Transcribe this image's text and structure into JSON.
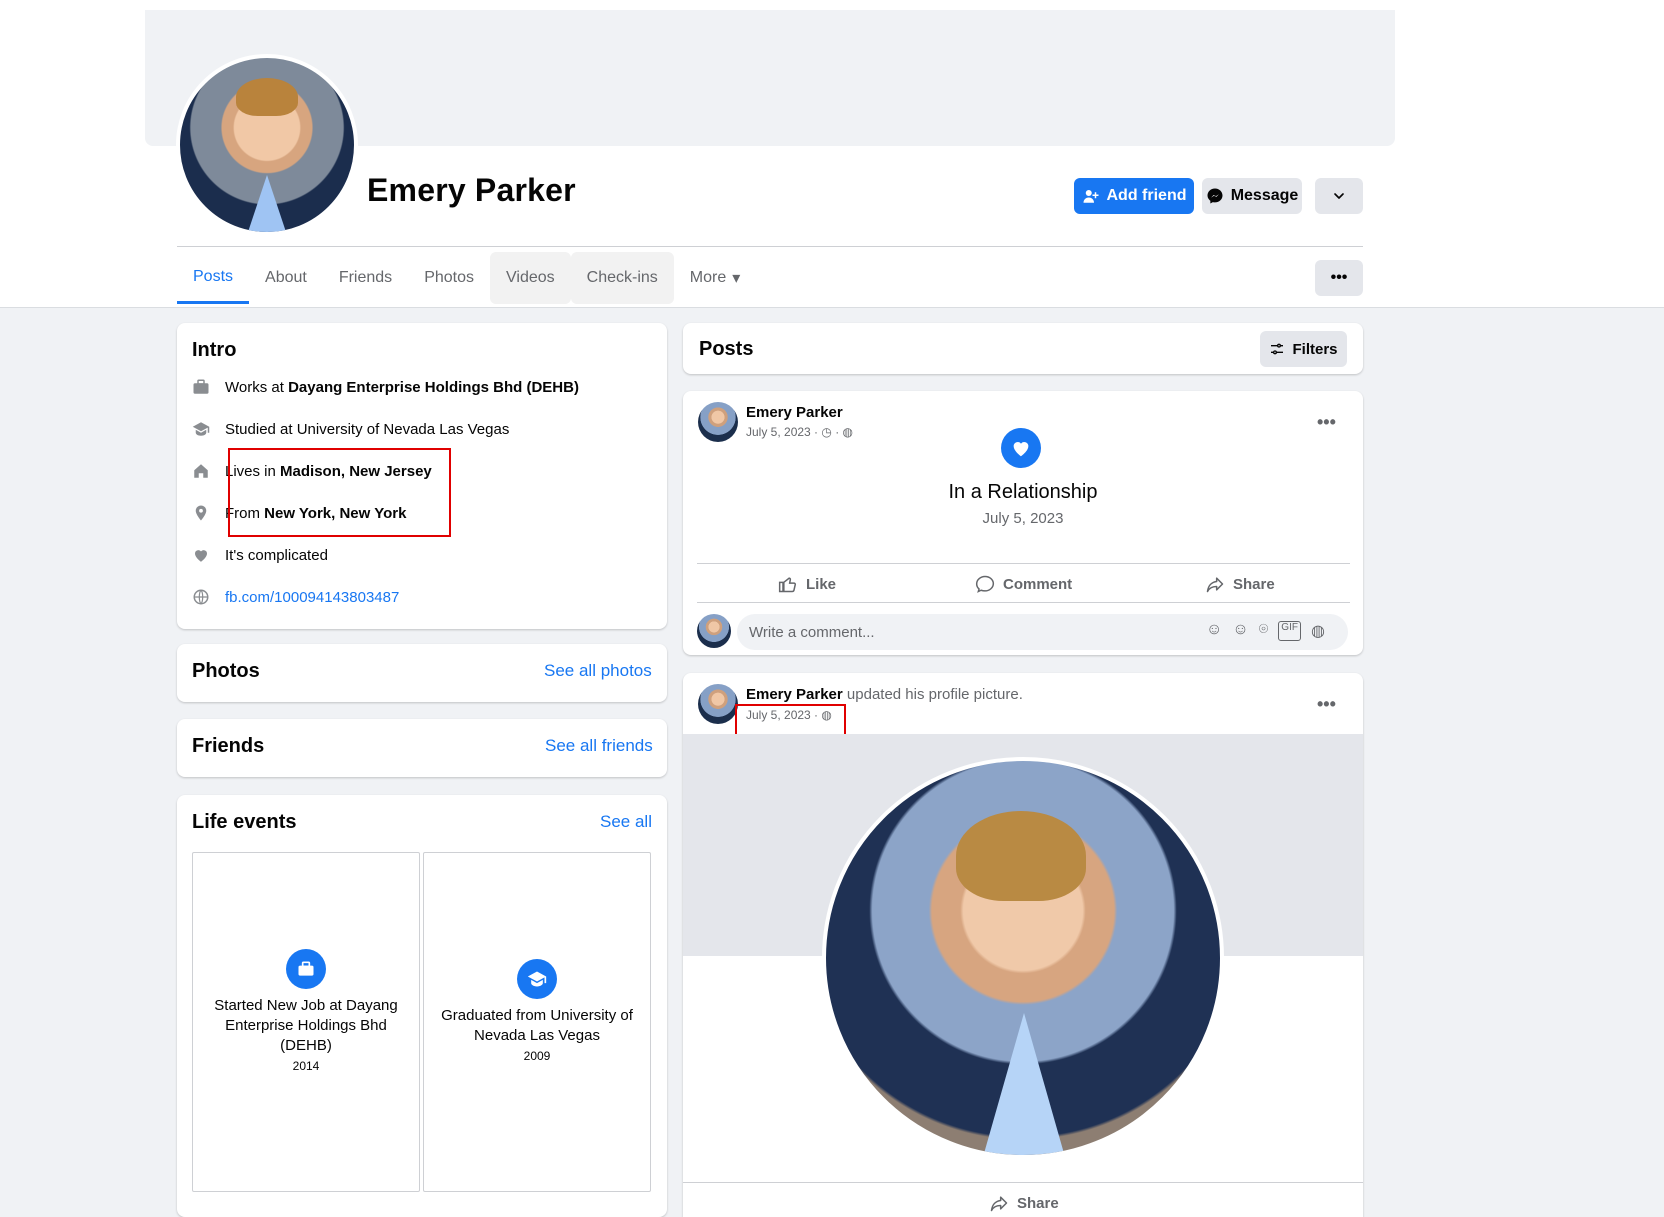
{
  "profile": {
    "name": "Emery Parker",
    "add_friend_label": "Add friend",
    "message_label": "Message"
  },
  "tabs": [
    "Posts",
    "About",
    "Friends",
    "Photos",
    "Videos",
    "Check-ins",
    "More"
  ],
  "intro": {
    "title": "Intro",
    "works_prefix": "Works at",
    "works_value": "Dayang Enterprise Holdings Bhd (DEHB)",
    "studied": "Studied at University of Nevada Las Vegas",
    "lives_prefix": "Lives in",
    "lives_value": "Madison, New Jersey",
    "from_prefix": "From",
    "from_value": "New York, New York",
    "relationship": "It's complicated",
    "profile_link": "fb.com/100094143803487"
  },
  "photos": {
    "title": "Photos",
    "see_all": "See all photos"
  },
  "friends": {
    "title": "Friends",
    "see_all": "See all friends"
  },
  "life_events": {
    "title": "Life events",
    "see_all": "See all",
    "items": [
      {
        "title": "Started New Job at Dayang Enterprise Holdings Bhd (DEHB)",
        "year": "2014",
        "icon": "briefcase-icon"
      },
      {
        "title": "Graduated from University of Nevada Las Vegas",
        "year": "2009",
        "icon": "graduation-cap-icon"
      }
    ]
  },
  "posts_header": {
    "title": "Posts",
    "filters_label": "Filters"
  },
  "post1": {
    "author": "Emery Parker",
    "date": "July 5, 2023",
    "event_title": "In a Relationship",
    "event_date": "July 5, 2023",
    "like_label": "Like",
    "comment_label": "Comment",
    "share_label": "Share",
    "comment_placeholder": "Write a comment..."
  },
  "post2": {
    "author": "Emery Parker",
    "action_text": "updated his profile picture.",
    "date": "July 5, 2023",
    "share_label": "Share"
  },
  "colors": {
    "accent": "#1877f2",
    "background": "#f0f2f5",
    "highlight_box": "#e00000"
  }
}
